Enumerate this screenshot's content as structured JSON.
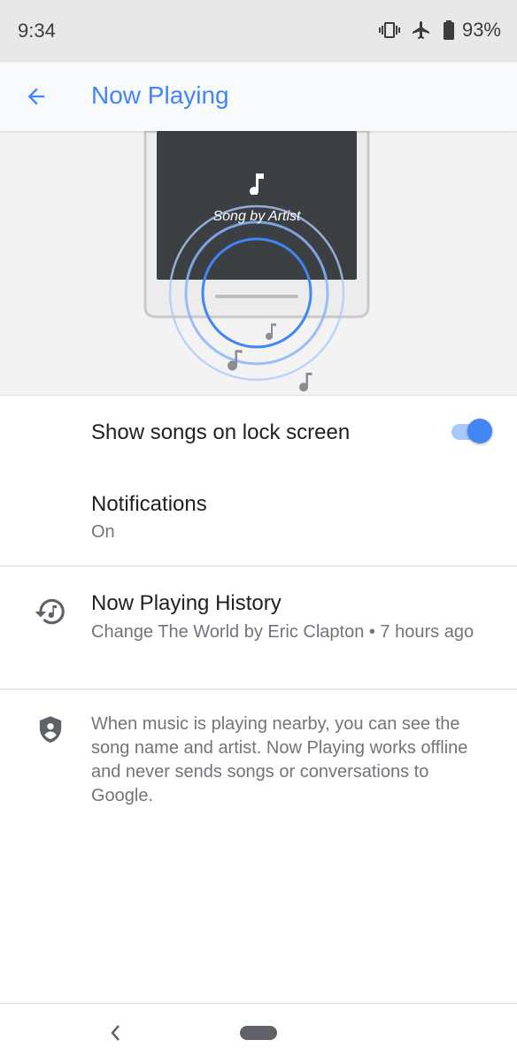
{
  "status_bar": {
    "time": "9:34",
    "icons": [
      "vibrate-icon",
      "airplane-mode-icon",
      "battery-icon"
    ],
    "battery_percent": "93%"
  },
  "app_bar": {
    "back_icon": "arrow-back-icon",
    "title": "Now Playing"
  },
  "hero": {
    "illustration_text": "Song by Artist",
    "icons": [
      "music-note-icon"
    ]
  },
  "settings": {
    "lock_screen": {
      "title": "Show songs on lock screen",
      "enabled": true
    },
    "notifications": {
      "title": "Notifications",
      "value": "On"
    },
    "history": {
      "icon": "history-icon",
      "title": "Now Playing History",
      "subtitle": "Change The World by Eric Clapton • 7 hours ago"
    }
  },
  "info": {
    "icon": "privacy-shield-icon",
    "text": "When music is playing nearby, you can see the song name and artist. Now Playing works offline and never sends songs or conversations to Google."
  },
  "nav_bar": {
    "back_icon": "nav-back-icon",
    "home_icon": "home-pill-icon"
  },
  "colors": {
    "accent": "#4285f4",
    "toggle_track": "#a8c7fa",
    "secondary_text": "#70757a",
    "status_bar_bg": "#e8e8e8",
    "hero_bg": "#f3f3f3"
  }
}
